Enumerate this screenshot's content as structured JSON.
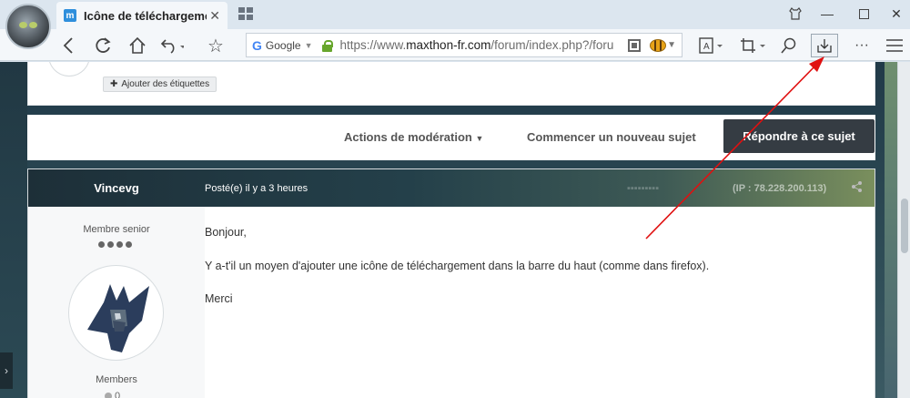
{
  "browser": {
    "tab_title": "Icône de téléchargeme...",
    "tab_favicon": "m",
    "search_engine": "Google",
    "url_prefix": "https://www.",
    "url_domain": "maxthon-fr.com",
    "url_rest": "/forum/index.php?/foru"
  },
  "page": {
    "add_tags_label": "Ajouter des étiquettes",
    "moderation_label": "Actions de modération",
    "new_topic_label": "Commencer un nouveau sujet",
    "reply_label": "Répondre à ce sujet"
  },
  "post": {
    "author": "Vincevg",
    "posted": "Posté(e) il y a 3 heures",
    "ip": "(IP : 78.228.200.113)",
    "rank": "Membre senior",
    "group": "Members",
    "post_count": "0",
    "body": {
      "line1": "Bonjour,",
      "line2": "Y a-t'il un moyen d'ajouter une icône de téléchargement dans la barre du haut (comme dans firefox).",
      "line3": "Merci"
    }
  },
  "annotation": {
    "color": "#e01010"
  }
}
